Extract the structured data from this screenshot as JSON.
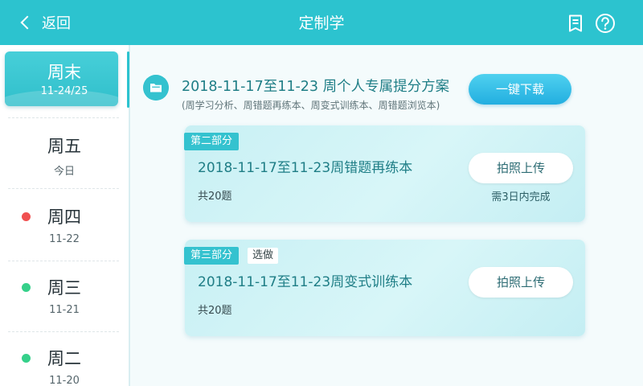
{
  "topbar": {
    "back_label": "返回",
    "title": "定制学",
    "bg": "#2cc3cf"
  },
  "sidebar": {
    "days": [
      {
        "name": "周末",
        "date": "11-24/25",
        "active": true
      },
      {
        "name": "周五",
        "date": "今日"
      },
      {
        "name": "周四",
        "date": "11-22",
        "status_color": "#f05050"
      },
      {
        "name": "周三",
        "date": "11-21",
        "status_color": "#35d08a"
      },
      {
        "name": "周二",
        "date": "11-20",
        "status_color": "#35d08a"
      }
    ]
  },
  "plan": {
    "title": "2018-11-17至11-23 周个人专属提分方案",
    "subtitle": "(周学习分析、周错题再练本、周变式训练本、周错题浏览本)",
    "download_label": "一键下载"
  },
  "tasks": [
    {
      "tag": "第二部分",
      "title": "2018-11-17至11-23周错题再练本",
      "count": "共20题",
      "upload_label": "拍照上传",
      "deadline": "需3日内完成"
    },
    {
      "tag": "第三部分",
      "optional": "选做",
      "title": "2018-11-17至11-23周变式训练本",
      "count": "共20题",
      "upload_label": "拍照上传"
    }
  ],
  "icons": {
    "back": "chevron-left-icon",
    "report": "document-icon",
    "help": "help-circle-icon",
    "folder": "folder-icon"
  }
}
